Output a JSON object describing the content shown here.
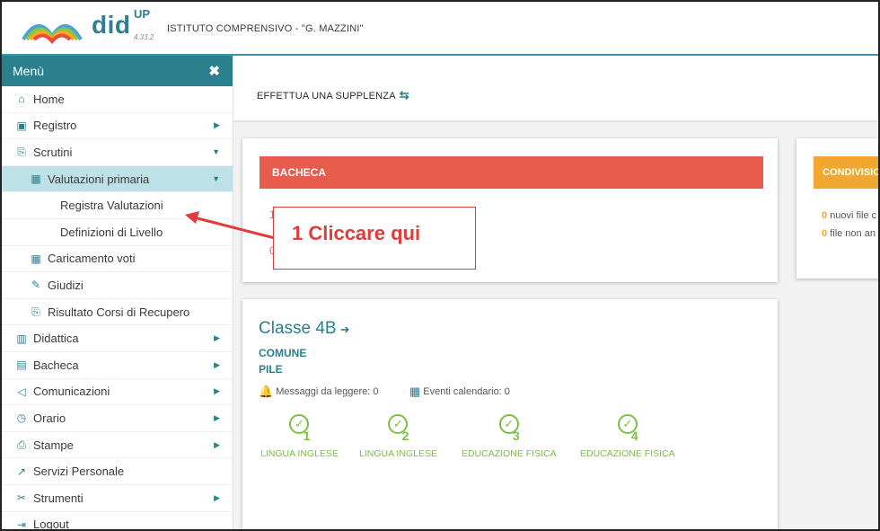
{
  "header": {
    "brand": "did",
    "brand_sup": "UP",
    "version": "4.33.2",
    "school": "ISTITUTO COMPRENSIVO - \"G. MAZZINI\""
  },
  "sidebar": {
    "title": "Menù",
    "close": "✖",
    "items": [
      {
        "label": "Home"
      },
      {
        "label": "Registro"
      },
      {
        "label": "Scrutini"
      },
      {
        "label": "Valutazioni primaria"
      },
      {
        "label": "Registra Valutazioni"
      },
      {
        "label": "Definizioni di Livello"
      },
      {
        "label": "Caricamento voti"
      },
      {
        "label": "Giudizi"
      },
      {
        "label": "Risultato Corsi di Recupero"
      },
      {
        "label": "Didattica"
      },
      {
        "label": "Bacheca"
      },
      {
        "label": "Comunicazioni"
      },
      {
        "label": "Orario"
      },
      {
        "label": "Stampe"
      },
      {
        "label": "Servizi Personale"
      },
      {
        "label": "Strumenti"
      },
      {
        "label": "Logout"
      }
    ]
  },
  "main": {
    "supplenza": "EFFETTUA UNA SUPPLENZA",
    "bacheca": {
      "title": "BACHECA",
      "line1": "1",
      "line2": "0"
    },
    "condivisione": {
      "title": "CONDIVISIONE",
      "new_files_count": "0",
      "new_files_text": "nuovi file c",
      "unread_count": "0",
      "unread_text": "file non an"
    },
    "classe": {
      "title": "Classe 4B",
      "sub1": "COMUNE",
      "sub2": "PILE",
      "messaggi": "Messaggi da leggere: 0",
      "eventi": "Eventi calendario: 0",
      "subjects": [
        {
          "num": "1",
          "name": "LINGUA INGLESE"
        },
        {
          "num": "2",
          "name": "LINGUA INGLESE"
        },
        {
          "num": "3",
          "name": "EDUCAZIONE FISICA"
        },
        {
          "num": "4",
          "name": "EDUCAZIONE FISICA"
        }
      ]
    }
  },
  "annotation": {
    "text": "1 Cliccare qui",
    "color": "#e23b3b"
  },
  "colors": {
    "primary": "#2c7f8c",
    "bacheca": "#e85c4b",
    "condivisione": "#f2a830",
    "success": "#7bbf45"
  }
}
